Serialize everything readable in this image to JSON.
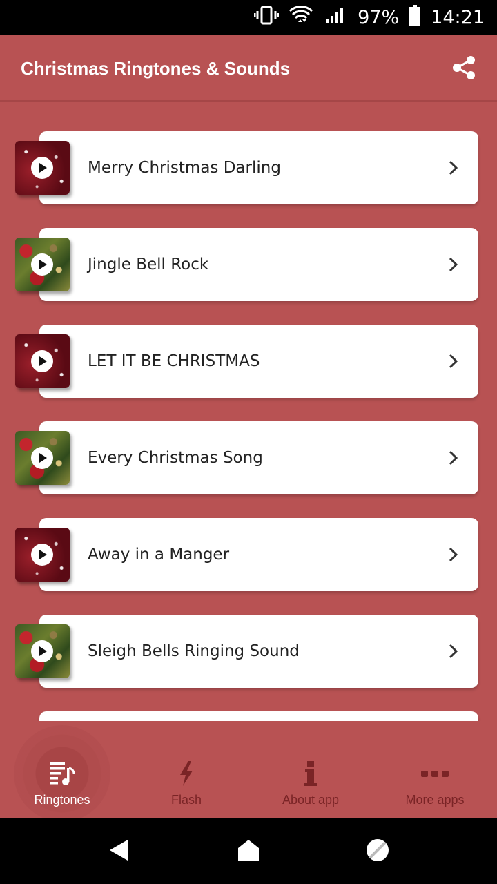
{
  "status_bar": {
    "battery_percent": "97%",
    "time": "14:21",
    "icons": [
      "vibrate-icon",
      "wifi-icon",
      "signal-icon",
      "battery-icon"
    ]
  },
  "app_bar": {
    "title": "Christmas Ringtones & Sounds",
    "share_icon": "share-icon"
  },
  "ringtones": [
    {
      "title": "Merry Christmas Darling",
      "thumbnail": "sparkle"
    },
    {
      "title": "Jingle Bell Rock",
      "thumbnail": "tree"
    },
    {
      "title": "LET IT BE CHRISTMAS",
      "thumbnail": "sparkle"
    },
    {
      "title": "Every Christmas Song",
      "thumbnail": "tree"
    },
    {
      "title": "Away in a Manger",
      "thumbnail": "sparkle"
    },
    {
      "title": "Sleigh Bells Ringing Sound",
      "thumbnail": "tree"
    }
  ],
  "bottom_nav": [
    {
      "label": "Ringtones",
      "icon": "music-list-icon",
      "active": true
    },
    {
      "label": "Flash",
      "icon": "flash-icon",
      "active": false
    },
    {
      "label": "About app",
      "icon": "info-icon",
      "active": false
    },
    {
      "label": "More apps",
      "icon": "more-icon",
      "active": false
    }
  ],
  "colors": {
    "primary": "#b85253",
    "card": "#ffffff",
    "inactive_nav": "#7a2426",
    "active_nav": "#ffffff"
  }
}
